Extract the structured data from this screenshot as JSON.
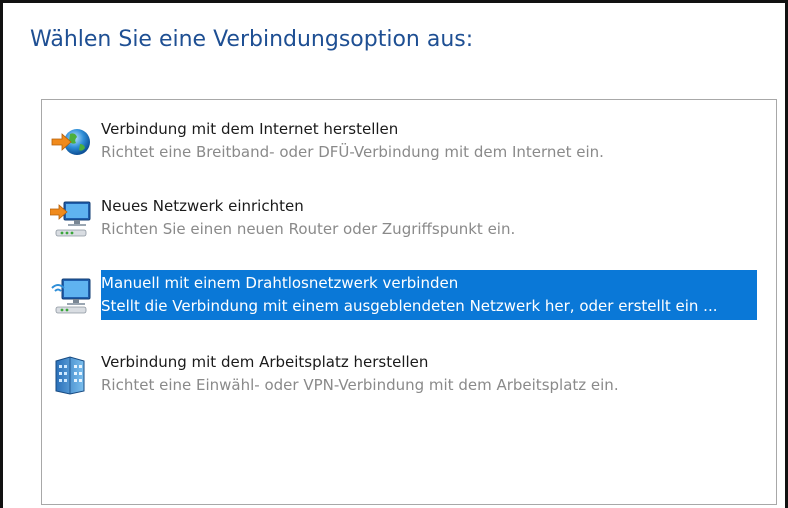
{
  "heading": "Wählen Sie eine Verbindungsoption aus:",
  "colors": {
    "heading": "#1e4f93",
    "selection": "#0a78d7",
    "description": "#8a8a8a"
  },
  "options": [
    {
      "title": "Verbindung mit dem Internet herstellen",
      "description": "Richtet eine Breitband- oder DFÜ-Verbindung mit dem Internet ein.",
      "icon": "globe-arrow-icon",
      "selected": false
    },
    {
      "title": "Neues Netzwerk einrichten",
      "description": "Richten Sie einen neuen Router oder Zugriffspunkt ein.",
      "icon": "network-setup-icon",
      "selected": false
    },
    {
      "title": "Manuell mit einem Drahtlosnetzwerk verbinden",
      "description": "Stellt die Verbindung mit einem ausgeblendeten Netzwerk her, oder erstellt ein ...",
      "icon": "wireless-network-icon",
      "selected": true
    },
    {
      "title": "Verbindung mit dem Arbeitsplatz herstellen",
      "description": "Richtet eine Einwähl- oder VPN-Verbindung mit dem Arbeitsplatz ein.",
      "icon": "workplace-icon",
      "selected": false
    }
  ]
}
